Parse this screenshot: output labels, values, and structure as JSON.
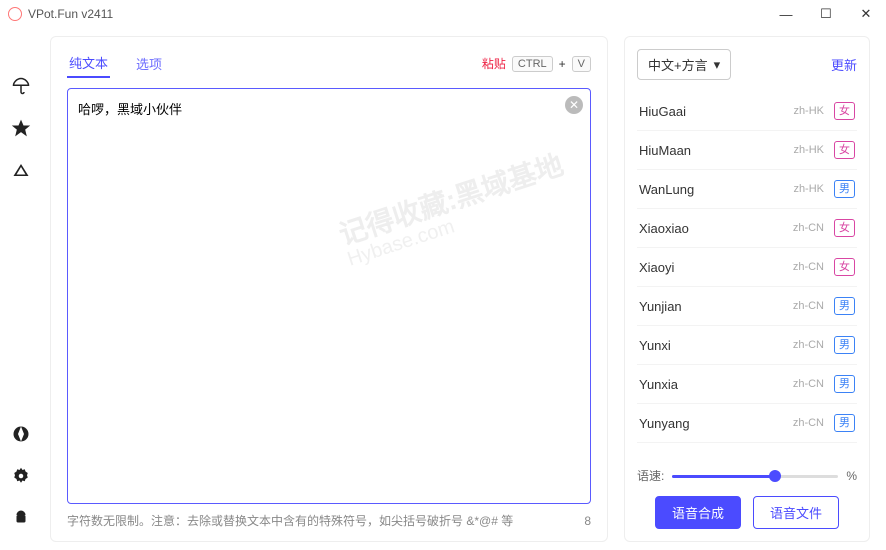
{
  "window": {
    "title": "VPot.Fun v2411",
    "minimize": "—",
    "maximize": "☐",
    "close": "✕"
  },
  "tabs": {
    "plain": "纯文本",
    "options": "选项"
  },
  "paste": {
    "label": "粘贴",
    "kbd_ctrl": "CTRL",
    "kbd_plus": "+",
    "kbd_v": "V"
  },
  "textarea": {
    "value": "哈啰，黑域小伙伴",
    "clear": "✕"
  },
  "footer": {
    "hint": "字符数无限制。注意：去除或替换文本中含有的特殊符号，如尖括号破折号 &*@# 等",
    "count": "8"
  },
  "right": {
    "dropdown": "中文+方言",
    "caret": "▾",
    "refresh": "更新"
  },
  "voices": [
    {
      "name": "HiuGaai",
      "locale": "zh-HK",
      "gender": "女",
      "g": "f"
    },
    {
      "name": "HiuMaan",
      "locale": "zh-HK",
      "gender": "女",
      "g": "f"
    },
    {
      "name": "WanLung",
      "locale": "zh-HK",
      "gender": "男",
      "g": "m"
    },
    {
      "name": "Xiaoxiao",
      "locale": "zh-CN",
      "gender": "女",
      "g": "f"
    },
    {
      "name": "Xiaoyi",
      "locale": "zh-CN",
      "gender": "女",
      "g": "f"
    },
    {
      "name": "Yunjian",
      "locale": "zh-CN",
      "gender": "男",
      "g": "m"
    },
    {
      "name": "Yunxi",
      "locale": "zh-CN",
      "gender": "男",
      "g": "m"
    },
    {
      "name": "Yunxia",
      "locale": "zh-CN",
      "gender": "男",
      "g": "m"
    },
    {
      "name": "Yunyang",
      "locale": "zh-CN",
      "gender": "男",
      "g": "m"
    }
  ],
  "speed": {
    "label": "语速:",
    "unit": "%"
  },
  "buttons": {
    "synth": "语音合成",
    "file": "语音文件"
  },
  "watermark": {
    "l1": "记得收藏:黑域基地",
    "l2": "Hybase.com"
  }
}
